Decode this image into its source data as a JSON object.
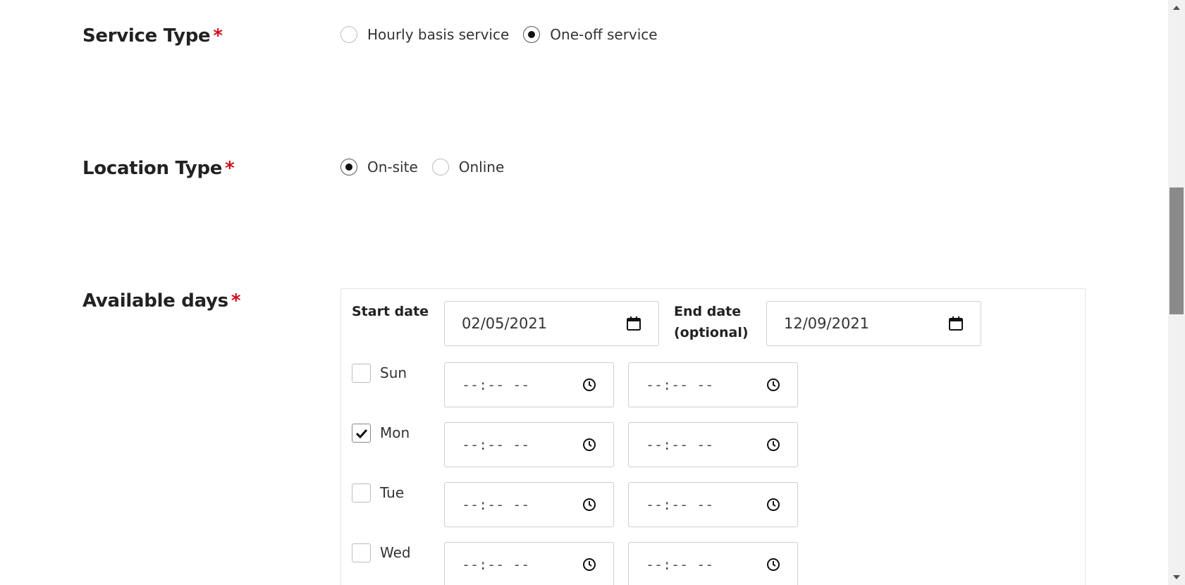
{
  "service_type": {
    "label": "Service Type",
    "required_mark": "*",
    "options": [
      {
        "label": "Hourly basis service",
        "checked": false
      },
      {
        "label": "One-off service",
        "checked": true
      }
    ]
  },
  "location_type": {
    "label": "Location Type",
    "required_mark": "*",
    "options": [
      {
        "label": "On-site",
        "checked": true
      },
      {
        "label": "Online",
        "checked": false
      }
    ]
  },
  "available_days": {
    "label": "Available days",
    "required_mark": "*",
    "start_date_label": "Start date",
    "start_date_value": "02/05/2021",
    "end_date_label_line1": "End date",
    "end_date_label_line2": "(optional)",
    "end_date_value": "12/09/2021",
    "days": [
      {
        "label": "Sun",
        "checked": false,
        "from": "--:-- --",
        "to": "--:-- --"
      },
      {
        "label": "Mon",
        "checked": true,
        "from": "--:-- --",
        "to": "--:-- --"
      },
      {
        "label": "Tue",
        "checked": false,
        "from": "--:-- --",
        "to": "--:-- --"
      },
      {
        "label": "Wed",
        "checked": false,
        "from": "--:-- --",
        "to": "--:-- --"
      }
    ]
  },
  "icons": {
    "calendar": "calendar-icon",
    "clock": "clock-icon",
    "check": "check-icon"
  }
}
